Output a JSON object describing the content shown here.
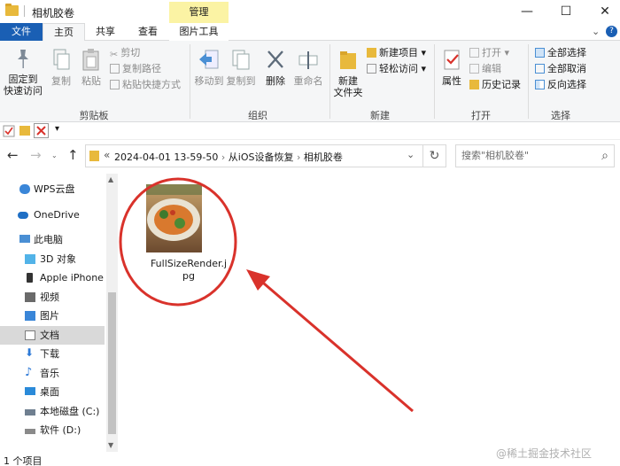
{
  "window": {
    "title": "相机胶卷",
    "minimize": "—",
    "maximize": "☐",
    "close": "✕"
  },
  "tabs": {
    "file": "文件",
    "home": "主页",
    "share": "共享",
    "view": "查看",
    "manage": "管理",
    "picture_tools": "图片工具",
    "collapse": "⌄",
    "help": "?"
  },
  "ribbon": {
    "clipboard": {
      "pin": "固定到\n快速访问",
      "copy": "复制",
      "paste": "粘贴",
      "cut": "剪切",
      "copy_path": "复制路径",
      "paste_shortcut": "粘贴快捷方式",
      "label": "剪贴板"
    },
    "organize": {
      "move_to": "移动到",
      "copy_to": "复制到",
      "delete": "删除",
      "rename": "重命名",
      "label": "组织"
    },
    "new": {
      "new_folder": "新建\n文件夹",
      "new_item": "新建项目",
      "easy_access": "轻松访问",
      "label": "新建"
    },
    "open": {
      "properties": "属性",
      "open": "打开",
      "edit": "编辑",
      "history": "历史记录",
      "label": "打开"
    },
    "select": {
      "select_all": "全部选择",
      "select_none": "全部取消",
      "invert": "反向选择",
      "label": "选择"
    }
  },
  "address": {
    "chevrons": "«",
    "crumbs": [
      "2024-04-01 13-59-50",
      "从iOS设备恢复",
      "相机胶卷"
    ],
    "sep": "›",
    "dropdown": "⌄",
    "refresh": "↻",
    "search_placeholder": "搜索\"相机胶卷\"",
    "search_icon": "⌕"
  },
  "nav": [
    {
      "label": "WPS云盘",
      "icon": "cloud-icon",
      "color": "#3a86d8"
    },
    {
      "label": "OneDrive",
      "icon": "onedrive-icon",
      "color": "#1f6fc5"
    },
    {
      "label": "此电脑",
      "icon": "computer-icon",
      "color": "#4a8fd4"
    },
    {
      "label": "3D 对象",
      "icon": "cube-icon",
      "color": "#52b3e8"
    },
    {
      "label": "Apple iPhone",
      "icon": "phone-icon",
      "color": "#333333"
    },
    {
      "label": "视频",
      "icon": "video-icon",
      "color": "#6a6a6a"
    },
    {
      "label": "图片",
      "icon": "picture-icon",
      "color": "#3a86d8"
    },
    {
      "label": "文档",
      "icon": "document-icon",
      "color": "#7d7d7d"
    },
    {
      "label": "下载",
      "icon": "download-icon",
      "color": "#2b78d6"
    },
    {
      "label": "音乐",
      "icon": "music-icon",
      "color": "#2b78d6"
    },
    {
      "label": "桌面",
      "icon": "desktop-icon",
      "color": "#2a8ad9"
    },
    {
      "label": "本地磁盘 (C:)",
      "icon": "drive-icon",
      "color": "#6f7f90"
    },
    {
      "label": "软件 (D:)",
      "icon": "drive-icon",
      "color": "#8a8a8a"
    }
  ],
  "file": {
    "name_line1": "FullSizeRender.j",
    "name_line2": "pg"
  },
  "status": {
    "count": "1 个项目"
  },
  "watermark": "@稀土掘金技术社区"
}
